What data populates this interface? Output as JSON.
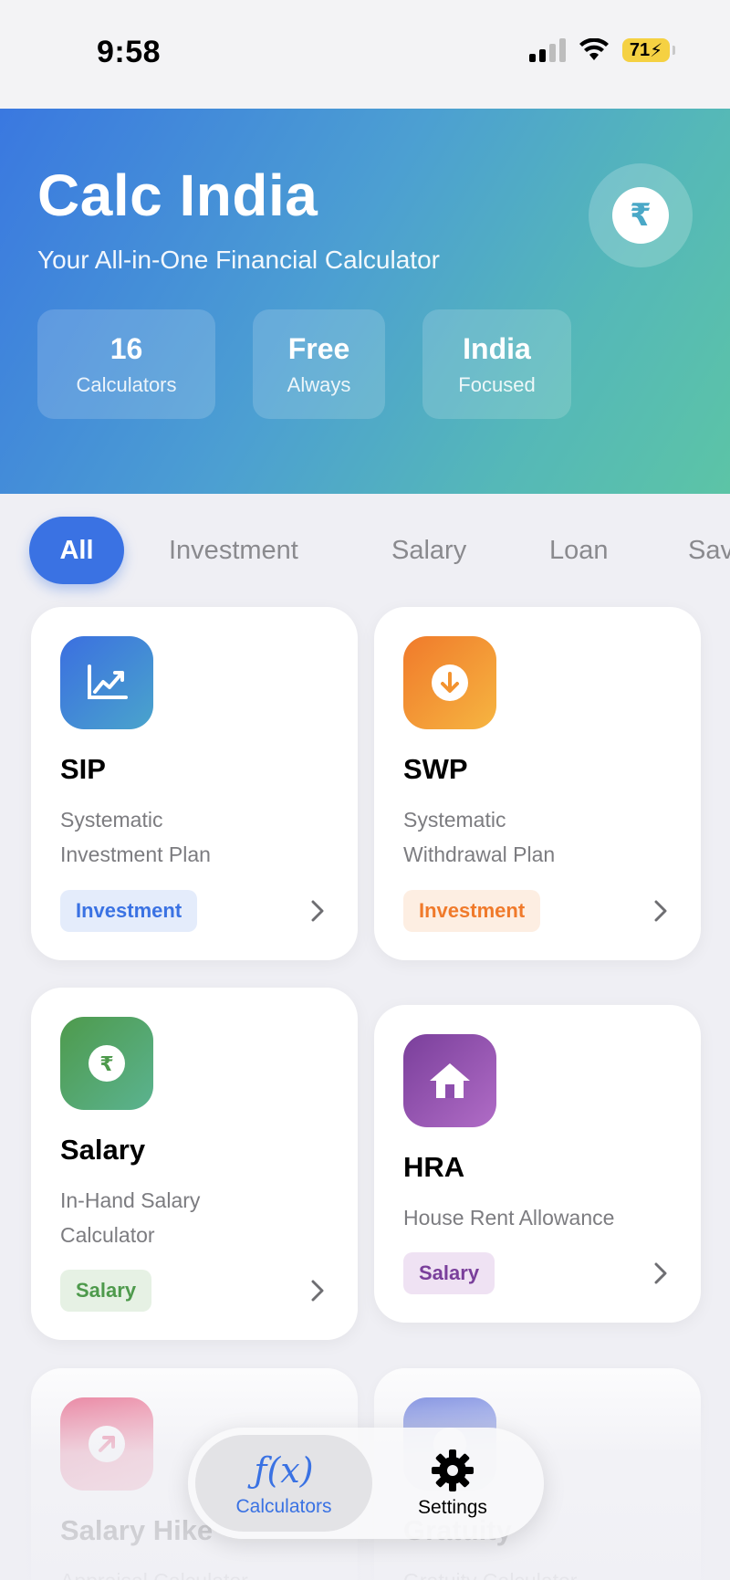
{
  "status_bar": {
    "time": "9:58",
    "battery": "71"
  },
  "header": {
    "title": "Calc India",
    "subtitle": "Your All-in-One Financial Calculator",
    "badge_symbol": "₹",
    "stats": [
      {
        "value": "16",
        "label": "Calculators"
      },
      {
        "value": "Free",
        "label": "Always"
      },
      {
        "value": "India",
        "label": "Focused"
      }
    ]
  },
  "categories": {
    "selected": "All",
    "items": [
      "All",
      "Investment",
      "Salary",
      "Loan",
      "Sav"
    ]
  },
  "calculators": [
    {
      "title": "SIP",
      "desc_line1": "Systematic",
      "desc_line2": "Investment Plan",
      "tag": "Investment",
      "icon": "chart-up-icon",
      "color": "#3b6fe0"
    },
    {
      "title": "SWP",
      "desc_line1": "Systematic",
      "desc_line2": "Withdrawal Plan",
      "tag": "Investment",
      "icon": "arrow-down-circle-icon",
      "color": "#f07a2b"
    },
    {
      "title": "Salary",
      "desc_line1": "In-Hand Salary",
      "desc_line2": "Calculator",
      "tag": "Salary",
      "icon": "rupee-circle-icon",
      "color": "#4e9a4c"
    },
    {
      "title": "HRA",
      "desc_line1": "House Rent Allowance",
      "desc_line2": "",
      "tag": "Salary",
      "icon": "house-icon",
      "color": "#7a3f9b"
    },
    {
      "title": "Salary Hike",
      "desc_line1": "Appraisal Calculator",
      "desc_line2": "",
      "tag": "",
      "icon": "arrow-up-right-circle-icon",
      "color": "#e8527a"
    },
    {
      "title": "Gratuity",
      "desc_line1": "Gratuity Calculator",
      "desc_line2": "",
      "tag": "",
      "icon": "gratuity-icon",
      "color": "#5067d9"
    }
  ],
  "tabbar": {
    "items": [
      {
        "label": "Calculators",
        "icon": "function-icon",
        "selected": true
      },
      {
        "label": "Settings",
        "icon": "gear-icon",
        "selected": false
      }
    ],
    "fx_symbol": "ƒ(x)"
  },
  "colors": {
    "accent": "#3a72e3",
    "hero_gradient_start": "#3a78e0",
    "hero_gradient_end": "#5cc4a6"
  }
}
